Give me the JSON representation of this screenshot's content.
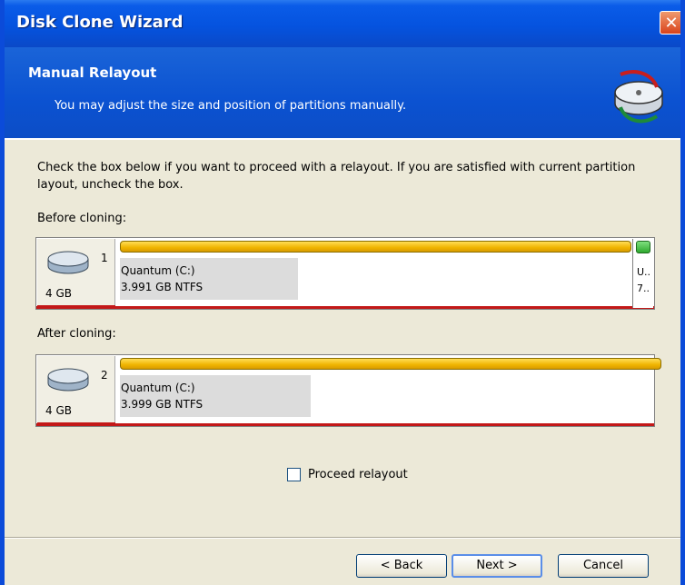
{
  "window": {
    "title": "Disk Clone Wizard",
    "close_label": "✕"
  },
  "header": {
    "title": "Manual Relayout",
    "subtitle": "You may adjust the size and position of partitions manually.",
    "icon": "disk-clone-icon"
  },
  "intro": "Check the box below if you want to proceed with a relayout. If you are satisfied with current partition layout, uncheck the box.",
  "before": {
    "label": "Before cloning:",
    "disk_number": "1",
    "disk_size": "4 GB",
    "partition_name": "Quantum (C:)",
    "partition_info": "3.991 GB  NTFS",
    "partition_fill": 0.9,
    "unallocated_line1": "U..",
    "unallocated_line2": "7.."
  },
  "after": {
    "label": "After cloning:",
    "disk_number": "2",
    "disk_size": "4 GB",
    "partition_name": "Quantum (C:)",
    "partition_info": "3.999 GB  NTFS"
  },
  "proceed": {
    "label": "Proceed relayout",
    "checked": false
  },
  "buttons": {
    "back": "< Back",
    "next": "Next >",
    "cancel": "Cancel"
  },
  "colors": {
    "titlebar": "#0553df",
    "partition_bar": "#f0b400",
    "unallocated_bar": "#2ea82e",
    "disk_underline": "#c31818"
  }
}
